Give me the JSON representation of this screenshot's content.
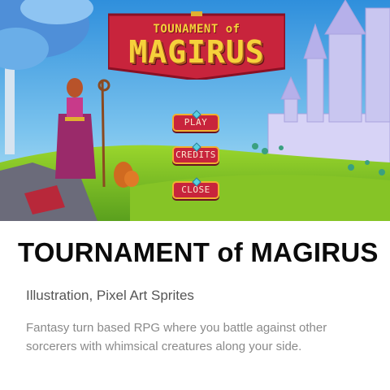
{
  "hero": {
    "game_logo": {
      "line1": "TOUNAMENT of",
      "line2": "MAGIRUS"
    },
    "menu": {
      "play": "PLAY",
      "credits": "CREDITS",
      "close": "CLOSE"
    }
  },
  "project": {
    "title": "TOURNAMENT of MAGIRUS",
    "category": "Illustration, Pixel Art Sprites",
    "description": "Fantasy turn based RPG where you battle against other sorcerers with whimsical creatures along your side."
  },
  "colors": {
    "banner": "#c8243c",
    "banner_text": "#f6d13b",
    "sky": "#3f9ee0",
    "grass": "#7cc02a"
  }
}
